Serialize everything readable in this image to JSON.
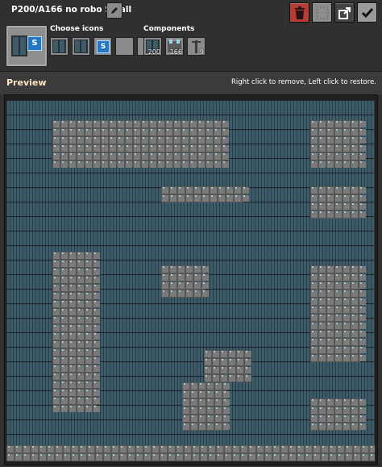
{
  "title": "P200/A166 no robo Small",
  "buttons": {
    "rename": "rename-icon",
    "delete": "trash-icon",
    "blank": "blank-slot-icon",
    "export": "export-icon",
    "confirm": "checkmark-icon"
  },
  "icons_section": {
    "label": "Choose icons",
    "slots": [
      "solar-panel-icon",
      "solar-panel-icon",
      "signal-s-icon",
      "empty-slot",
      "empty-slot"
    ]
  },
  "components_section": {
    "label": "Components",
    "items": [
      {
        "icon": "solar-panel-icon",
        "count": "200"
      },
      {
        "icon": "accumulator-icon",
        "count": "166"
      },
      {
        "icon": "medium-electric-pole-icon",
        "count": "9"
      }
    ]
  },
  "preview": {
    "label": "Preview",
    "hint": "Right click to remove, Left click to restore."
  },
  "colors": {
    "solar_panel": "#3d5b68",
    "accumulator": "#6d6d6d",
    "delete_button": "#b53d35",
    "preview_label": "#ffe6c0"
  }
}
